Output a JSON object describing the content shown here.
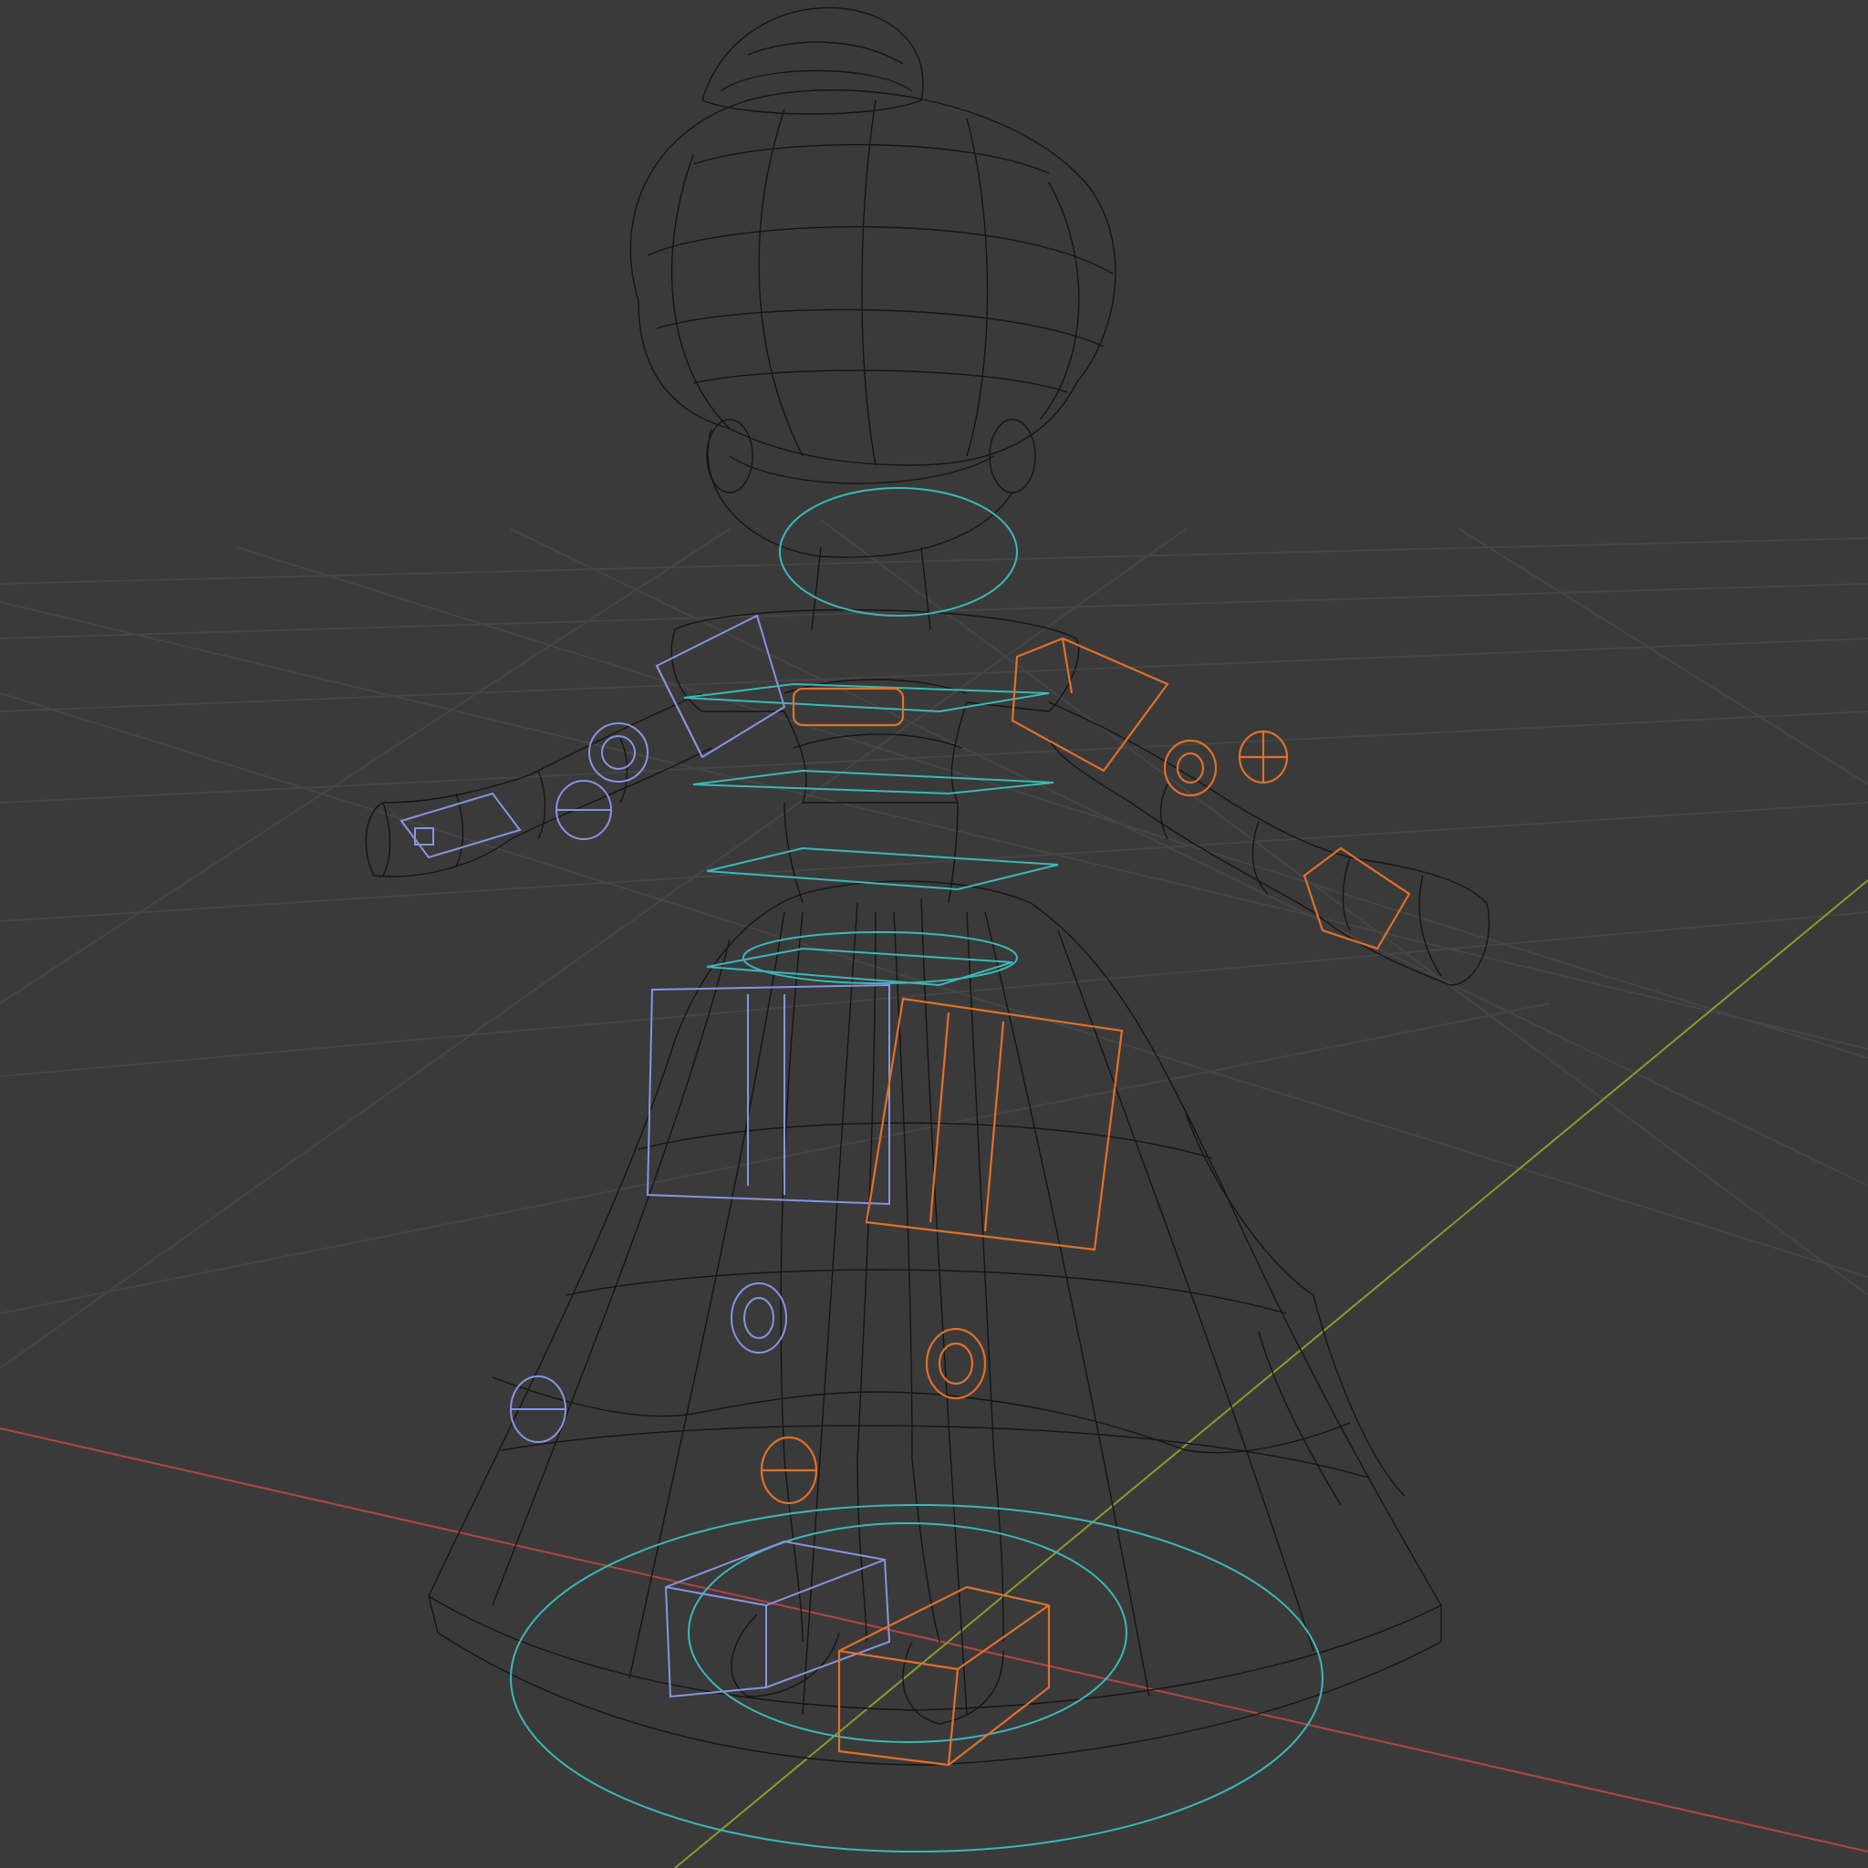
{
  "viewport": {
    "background": "#3a3a3a",
    "grid_color": "#454545",
    "axis_x_color": "#b34545",
    "axis_y_color": "#8a9a2e",
    "mesh_color": "#151515",
    "rig_colors": {
      "center_controls": "#3ab8b8",
      "left_side_controls": "#8a93e0",
      "right_side_controls": "#e0702a"
    }
  },
  "scene": {
    "object": "character-mesh-wireframe",
    "armature_controls": [
      "root-circle",
      "hip-ring",
      "spine-plane",
      "chest-plane",
      "neck-ellipse",
      "shoulder-box-left",
      "shoulder-box-right",
      "elbow-ring-left",
      "elbow-ring-right",
      "hand-box-left",
      "hand-box-right",
      "thigh-box-left",
      "thigh-box-right",
      "knee-ring-left",
      "knee-ring-right",
      "foot-box-left",
      "foot-box-right"
    ]
  }
}
